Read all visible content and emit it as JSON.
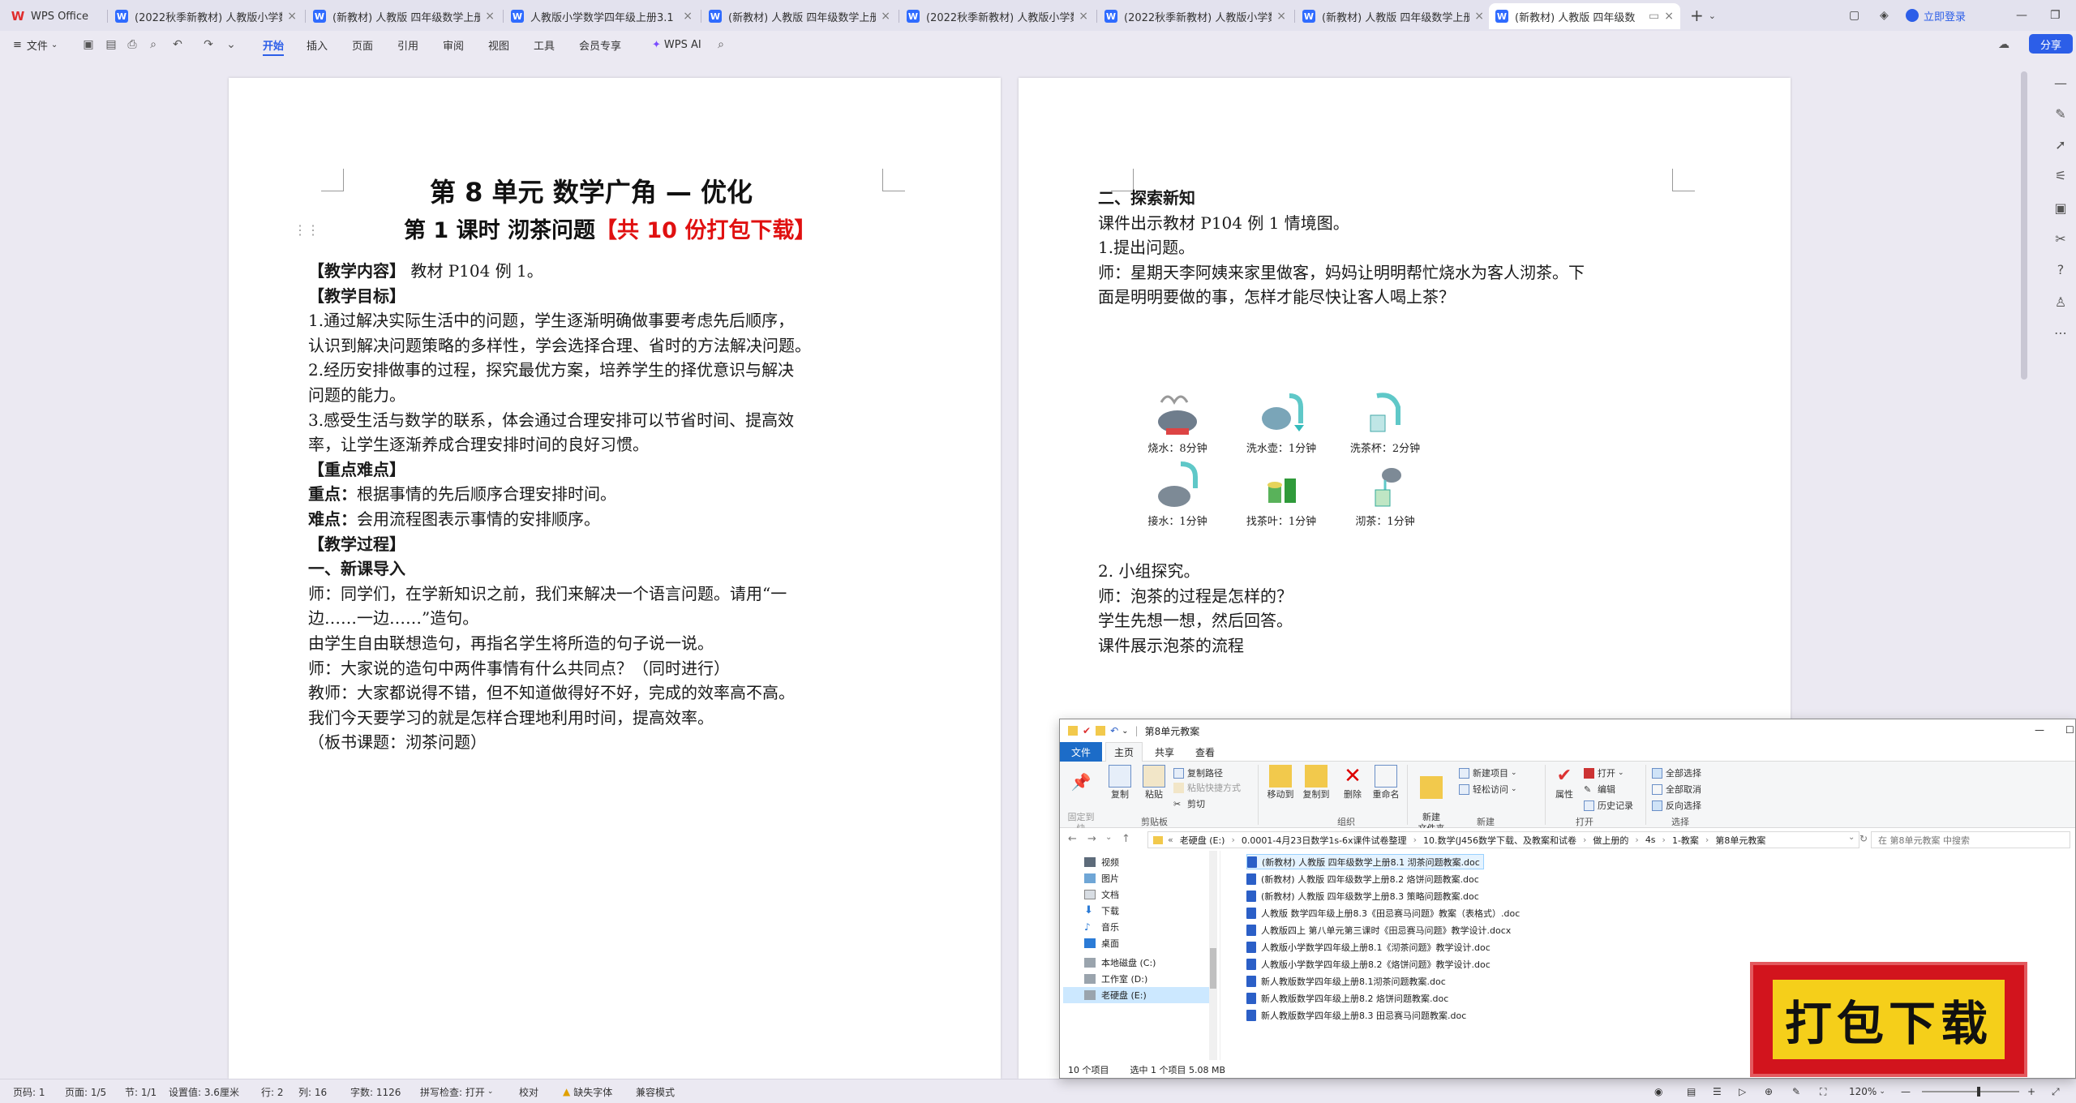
{
  "tabbar": {
    "tabs": [
      {
        "label": "WPS Office",
        "icon": "wps-logo-icon",
        "active": false
      },
      {
        "label": "(2022秋季新教材) 人教版小学数",
        "icon": "word-doc-icon",
        "active": false
      },
      {
        "label": "(新教材) 人教版 四年级数学上册",
        "icon": "word-doc-icon",
        "active": false
      },
      {
        "label": "人教版小学数学四年级上册3.1《认",
        "icon": "word-doc-icon",
        "active": false
      },
      {
        "label": "(新教材) 人教版 四年级数学上册",
        "icon": "word-doc-icon",
        "active": false
      },
      {
        "label": "(2022秋季新教材) 人教版小学数",
        "icon": "word-doc-icon",
        "active": false
      },
      {
        "label": "(2022秋季新教材) 人教版小学数",
        "icon": "word-doc-icon",
        "active": false
      },
      {
        "label": "(新教材) 人教版 四年级数学上册",
        "icon": "word-doc-icon",
        "active": false
      },
      {
        "label": "(新教材) 人教版 四年级数",
        "icon": "word-doc-icon",
        "active": true
      }
    ],
    "login_label": "立即登录"
  },
  "menubar": {
    "file_label": "文件",
    "items": [
      "开始",
      "插入",
      "页面",
      "引用",
      "审阅",
      "视图",
      "工具",
      "会员专享"
    ],
    "active": "开始",
    "ai_label": "WPS AI",
    "share_label": "分享"
  },
  "left_page": {
    "title": "第 8 单元    数学广角 — 优化",
    "subtitle_main": "第 1 课时    沏茶问题",
    "subtitle_red": "【共 10 份打包下载】",
    "lines": [
      {
        "bold": "【教学内容】",
        "text": " 教材 P104 例 1。"
      },
      {
        "bold": "【教学目标】",
        "text": ""
      },
      {
        "bold": "",
        "text": "1.通过解决实际生活中的问题，学生逐渐明确做事要考虑先后顺序，"
      },
      {
        "bold": "",
        "text": "认识到解决问题策略的多样性，学会选择合理、省时的方法解决问题。"
      },
      {
        "bold": "",
        "text": "2.经历安排做事的过程，探究最优方案，培养学生的择优意识与解决"
      },
      {
        "bold": "",
        "text": "问题的能力。"
      },
      {
        "bold": "",
        "text": "3.感受生活与数学的联系，体会通过合理安排可以节省时间、提高效"
      },
      {
        "bold": "",
        "text": "率，让学生逐渐养成合理安排时间的良好习惯。"
      },
      {
        "bold": "【重点难点】",
        "text": ""
      },
      {
        "bold": "重点：",
        "text": "根据事情的先后顺序合理安排时间。"
      },
      {
        "bold": "难点：",
        "text": "会用流程图表示事情的安排顺序。"
      },
      {
        "bold": "【教学过程】",
        "text": ""
      },
      {
        "bold": "一、新课导入",
        "text": ""
      },
      {
        "bold": "",
        "text": "师：同学们，在学新知识之前，我们来解决一个语言问题。请用“一"
      },
      {
        "bold": "",
        "text": "边……一边……”造句。"
      },
      {
        "bold": "",
        "text": "由学生自由联想造句，再指名学生将所造的句子说一说。"
      },
      {
        "bold": "",
        "text": "师：大家说的造句中两件事情有什么共同点？（同时进行）"
      },
      {
        "bold": "",
        "text": "教师：大家都说得不错，但不知道做得好不好，完成的效率高不高。"
      },
      {
        "bold": "",
        "text": "我们今天要学习的就是怎样合理地利用时间，提高效率。"
      },
      {
        "bold": "",
        "text": "（板书课题：沏茶问题）"
      }
    ]
  },
  "right_page": {
    "lines_top": [
      {
        "bold": "二、探索新知",
        "text": ""
      },
      {
        "bold": "",
        "text": "课件出示教材 P104 例 1 情境图。"
      },
      {
        "bold": "",
        "text": "1.提出问题。"
      },
      {
        "bold": "",
        "text": "师：星期天李阿姨来家里做客，妈妈让明明帮忙烧水为客人沏茶。下"
      },
      {
        "bold": "",
        "text": "面是明明要做的事，怎样才能尽快让客人喝上茶？"
      }
    ],
    "illustration": [
      {
        "caption": "烧水：8分钟",
        "icon": "boiling-kettle-icon"
      },
      {
        "caption": "洗水壶：1分钟",
        "icon": "wash-kettle-icon"
      },
      {
        "caption": "洗茶杯：2分钟",
        "icon": "wash-cup-icon"
      },
      {
        "caption": "接水：1分钟",
        "icon": "fill-water-icon"
      },
      {
        "caption": "找茶叶：1分钟",
        "icon": "tea-leaves-icon"
      },
      {
        "caption": "沏茶：1分钟",
        "icon": "brew-tea-icon"
      }
    ],
    "lines_bottom": [
      {
        "bold": "",
        "text": "2. 小组探究。"
      },
      {
        "bold": "",
        "text": "师：泡茶的过程是怎样的？"
      },
      {
        "bold": "",
        "text": "学生先想一想，然后回答。"
      },
      {
        "bold": "",
        "text": "课件展示泡茶的流程"
      }
    ]
  },
  "explorer": {
    "title": "第8单元教案",
    "tabs": [
      "文件",
      "主页",
      "共享",
      "查看"
    ],
    "active_tab": "主页",
    "ribbon": {
      "pin_label": "固定到快\n速访问",
      "copy_label": "复制",
      "paste_label": "粘贴",
      "copy_path_label": "复制路径",
      "paste_shortcut_label": "粘贴快捷方式",
      "cut_label": "剪切",
      "move_to_label": "移动到",
      "copy_to_label": "复制到",
      "delete_label": "删除",
      "rename_label": "重命名",
      "new_folder_label": "新建\n文件夹",
      "new_item_label": "新建项目",
      "easy_access_label": "轻松访问",
      "properties_label": "属性",
      "open_label": "打开",
      "edit_label": "编辑",
      "history_label": "历史记录",
      "select_all_label": "全部选择",
      "select_none_label": "全部取消",
      "invert_label": "反向选择",
      "groups": [
        "剪贴板",
        "组织",
        "新建",
        "打开",
        "选择"
      ]
    },
    "address": [
      "老硬盘 (E:)",
      "0.0001-4月23日数学1s-6x课件试卷整理",
      "10.数学(J456数学下载、及教案和试卷",
      "做上册的",
      "4s",
      "1-教案",
      "第8单元教案"
    ],
    "search_placeholder": "在 第8单元教案 中搜索",
    "nav": [
      "视频",
      "图片",
      "文档",
      "下载",
      "音乐",
      "桌面",
      "本地磁盘 (C:)",
      "工作室 (D:)",
      "老硬盘 (E:)"
    ],
    "nav_selected": "老硬盘 (E:)",
    "files": [
      "(新教材) 人教版 四年级数学上册8.1  沏茶问题教案.doc",
      "(新教材) 人教版 四年级数学上册8.2  烙饼问题教案.doc",
      "(新教材) 人教版 四年级数学上册8.3  策略问题教案.doc",
      "人教版 数学四年级上册8.3《田忌赛马问题》教案（表格式）.doc",
      "人教版四上 第八单元第三课时《田忌赛马问题》教学设计.docx",
      "人教版小学数学四年级上册8.1《沏茶问题》教学设计.doc",
      "人教版小学数学四年级上册8.2《烙饼问题》教学设计.doc",
      "新人教版数学四年级上册8.1沏茶问题教案.doc",
      "新人教版数学四年级上册8.2 烙饼问题教案.doc",
      "新人教版数学四年级上册8.3 田忌赛马问题教案.doc"
    ],
    "selected_file_index": 0,
    "status_count": "10 个项目",
    "status_selected": "选中 1 个项目  5.08 MB"
  },
  "statusbar": {
    "page": "页码: 1",
    "pages": "页面: 1/5",
    "section": "节: 1/1",
    "setting": "设置值: 3.6厘米",
    "row": "行: 2",
    "col": "列: 16",
    "words": "字数: 1126",
    "spell": "拼写检查: 打开",
    "proof": "校对",
    "missing_font": "缺失字体",
    "compat": "兼容模式",
    "zoom": "120%"
  },
  "badge": {
    "text": "打包下载"
  }
}
